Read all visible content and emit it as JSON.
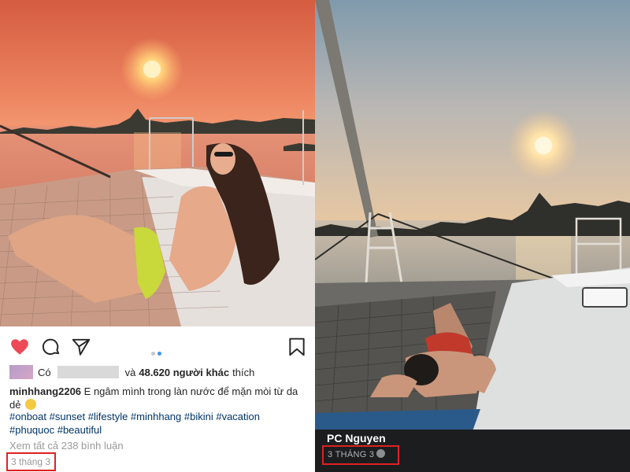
{
  "instagram": {
    "photo": {
      "subject": "sunset-boat-photo",
      "colors": {
        "sky_top": "#d9603f",
        "sky_bottom": "#f0906a",
        "sun": "#ffe7a1",
        "sea": "#e68f78"
      }
    },
    "carousel": {
      "total": 2,
      "active": 2
    },
    "likes": {
      "prefix": "Có",
      "middle": "và",
      "count": "48.620 người khác",
      "suffix": "thích"
    },
    "caption": {
      "username": "minhhang2206",
      "text": "E ngâm mình trong làn nước để mặn mòi từ da dẻ"
    },
    "hashtags": "#onboat #sunset #lifestyle #minhhang #bikini #vacation #phuquoc #beautiful",
    "view_comments": "Xem tất cả 238 bình luận",
    "date": "3 tháng 3",
    "accent_colors": {
      "heart": "#ed4956",
      "hashtag": "#003569",
      "highlight_box": "#e02020"
    }
  },
  "facebook": {
    "photo": {
      "subject": "sunset-catamaran-photo",
      "colors": {
        "sky_top": "#8ca4b4",
        "sky_bottom": "#e9c9a3",
        "sun": "#fff4cf",
        "sea": "#c2b6a6"
      }
    },
    "author": "PC Nguyen",
    "date": "3 THÁNG 3",
    "privacy_icon": "globe-icon"
  }
}
